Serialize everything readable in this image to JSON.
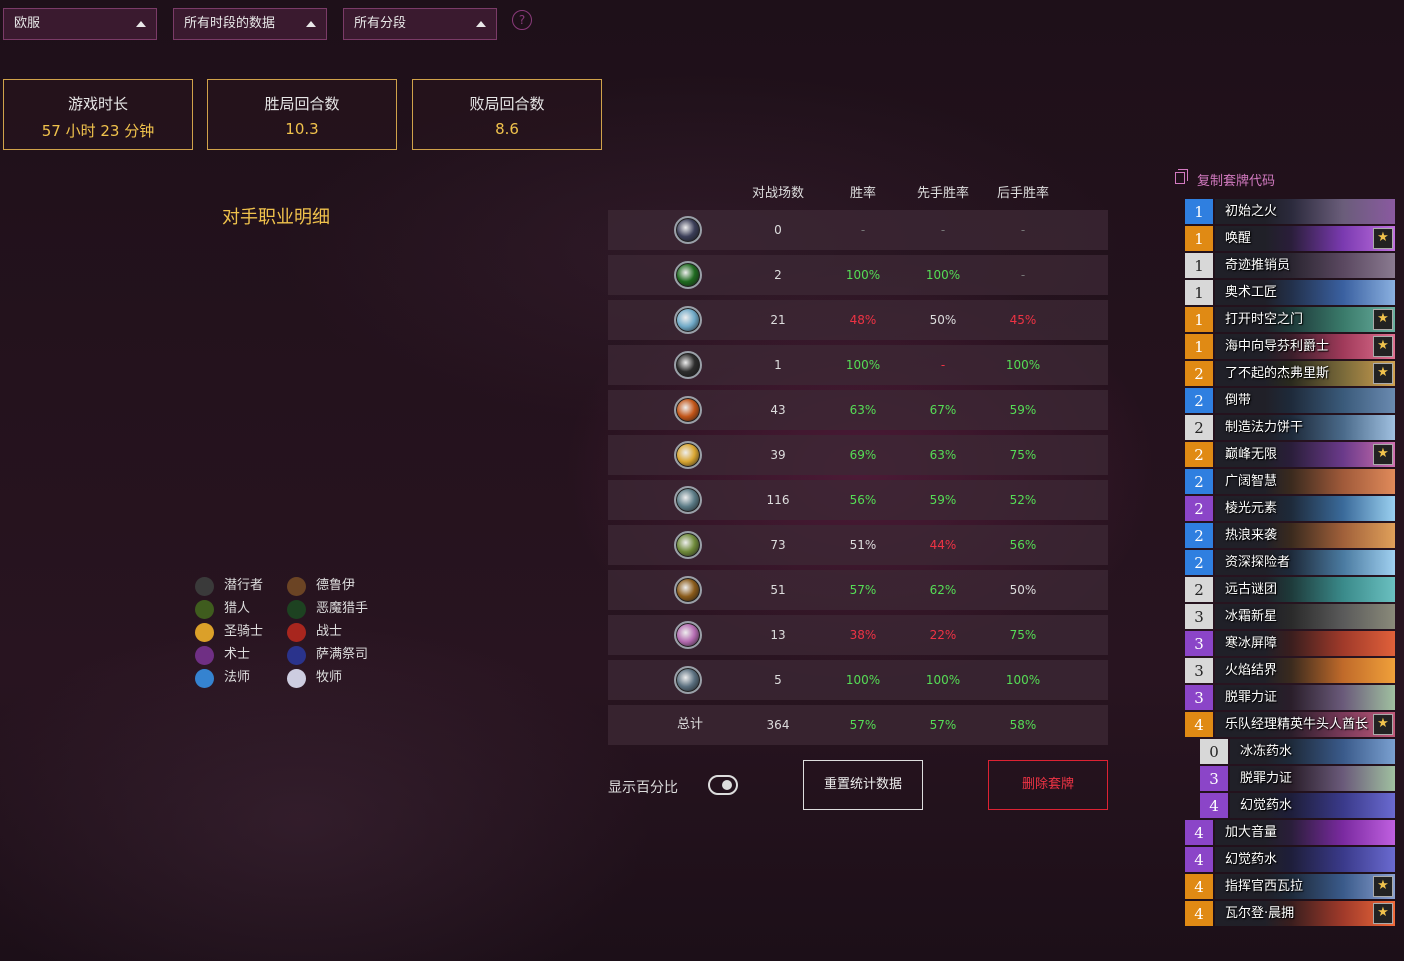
{
  "filters": {
    "region": "欧服",
    "time_range": "所有时段的数据",
    "rank": "所有分段",
    "help": "?"
  },
  "stats": [
    {
      "label": "游戏时长",
      "value": "57 小时 23 分钟"
    },
    {
      "label": "胜局回合数",
      "value": "10.3"
    },
    {
      "label": "败局回合数",
      "value": "8.6"
    }
  ],
  "section_title": "对手职业明细",
  "legend": [
    {
      "label": "潜行者",
      "color": "#3a3a3a"
    },
    {
      "label": "德鲁伊",
      "color": "#6b4424"
    },
    {
      "label": "猎人",
      "color": "#3f5c1e"
    },
    {
      "label": "恶魔猎手",
      "color": "#1d4221"
    },
    {
      "label": "圣骑士",
      "color": "#dba029"
    },
    {
      "label": "战士",
      "color": "#a8261e"
    },
    {
      "label": "术士",
      "color": "#6f2f84"
    },
    {
      "label": "萨满祭司",
      "color": "#2a338c"
    },
    {
      "label": "法师",
      "color": "#3583d0"
    },
    {
      "label": "牧师",
      "color": "#cdcde0"
    }
  ],
  "table": {
    "headers": [
      "对战场数",
      "胜率",
      "先手胜率",
      "后手胜率"
    ],
    "rows": [
      {
        "icon": "unknown-class-icon",
        "icon_color": "#3b3e58",
        "games": "0",
        "wr": "-",
        "wr_s": "dash",
        "first": "-",
        "first_s": "dash",
        "second": "-",
        "second_s": "dash"
      },
      {
        "icon": "demon-hunter-icon",
        "icon_color": "#1f6a20",
        "games": "2",
        "wr": "100%",
        "wr_s": "good",
        "first": "100%",
        "first_s": "good",
        "second": "-",
        "second_s": "dash"
      },
      {
        "icon": "shaman-icon",
        "icon_color": "#6fa9c7",
        "games": "21",
        "wr": "48%",
        "wr_s": "bad",
        "first": "50%",
        "first_s": "neutral",
        "second": "45%",
        "second_s": "bad"
      },
      {
        "icon": "rogue-icon",
        "icon_color": "#2d2d2d",
        "games": "1",
        "wr": "100%",
        "wr_s": "good",
        "first": "-",
        "first_s": "bad",
        "second": "100%",
        "second_s": "good"
      },
      {
        "icon": "warrior-icon",
        "icon_color": "#c25518",
        "games": "43",
        "wr": "63%",
        "wr_s": "good",
        "first": "67%",
        "first_s": "good",
        "second": "59%",
        "second_s": "good"
      },
      {
        "icon": "paladin-icon",
        "icon_color": "#d9a632",
        "games": "39",
        "wr": "69%",
        "wr_s": "good",
        "first": "63%",
        "first_s": "good",
        "second": "75%",
        "second_s": "good"
      },
      {
        "icon": "priest-icon",
        "icon_color": "#5b7b86",
        "games": "116",
        "wr": "56%",
        "wr_s": "good",
        "first": "59%",
        "first_s": "good",
        "second": "52%",
        "second_s": "good"
      },
      {
        "icon": "hunter-icon",
        "icon_color": "#6f8a3a",
        "games": "73",
        "wr": "51%",
        "wr_s": "neutral",
        "first": "44%",
        "first_s": "bad",
        "second": "56%",
        "second_s": "good"
      },
      {
        "icon": "druid-icon",
        "icon_color": "#8a5b1a",
        "games": "51",
        "wr": "57%",
        "wr_s": "good",
        "first": "62%",
        "first_s": "good",
        "second": "50%",
        "second_s": "neutral"
      },
      {
        "icon": "mage-icon",
        "icon_color": "#b36bb0",
        "games": "13",
        "wr": "38%",
        "wr_s": "bad",
        "first": "22%",
        "first_s": "bad",
        "second": "75%",
        "second_s": "good"
      },
      {
        "icon": "warlock-icon",
        "icon_color": "#5a6f7f",
        "games": "5",
        "wr": "100%",
        "wr_s": "good",
        "first": "100%",
        "first_s": "good",
        "second": "100%",
        "second_s": "good"
      }
    ],
    "total": {
      "label": "总计",
      "games": "364",
      "wr": "57%",
      "first": "57%",
      "second": "58%"
    }
  },
  "controls": {
    "show_percent_label": "显示百分比",
    "reset_button": "重置统计数据",
    "delete_button": "删除套牌"
  },
  "deck": {
    "copy_label": "复制套牌代码",
    "cards": [
      {
        "cost": "1",
        "name": "初始之火",
        "rarity": "rare",
        "legendary": false,
        "art": [
          "#2b2a3c",
          "#6a5d7a",
          "#8a5aa0"
        ]
      },
      {
        "cost": "1",
        "name": "唤醒",
        "rarity": "legendary",
        "legendary": true,
        "art": [
          "#2a1e3a",
          "#7a3ab0",
          "#c070e0"
        ]
      },
      {
        "cost": "1",
        "name": "奇迹推销员",
        "rarity": "common",
        "legendary": false,
        "art": [
          "#2a2530",
          "#5a4860",
          "#8a7a90"
        ]
      },
      {
        "cost": "1",
        "name": "奥术工匠",
        "rarity": "common",
        "legendary": false,
        "art": [
          "#22304a",
          "#3a60a0",
          "#8ab0e0"
        ]
      },
      {
        "cost": "1",
        "name": "打开时空之门",
        "rarity": "legendary",
        "legendary": true,
        "art": [
          "#1e3a3a",
          "#3a7a6a",
          "#6ab0a0"
        ]
      },
      {
        "cost": "1",
        "name": "海中向导芬利爵士",
        "rarity": "legendary",
        "legendary": true,
        "art": [
          "#3a1e2a",
          "#a03a5a",
          "#e07090"
        ]
      },
      {
        "cost": "2",
        "name": "了不起的杰弗里斯",
        "rarity": "legendary",
        "legendary": true,
        "art": [
          "#2a2a1e",
          "#7a6a3a",
          "#d0a050"
        ]
      },
      {
        "cost": "2",
        "name": "倒带",
        "rarity": "rare",
        "legendary": false,
        "art": [
          "#1e2a3a",
          "#3a5a7a",
          "#6a8ab0"
        ]
      },
      {
        "cost": "2",
        "name": "制造法力饼干",
        "rarity": "common",
        "legendary": false,
        "art": [
          "#1e2a3a",
          "#4a6a8a",
          "#a0c0e0"
        ]
      },
      {
        "cost": "2",
        "name": "巅峰无限",
        "rarity": "legendary",
        "legendary": true,
        "art": [
          "#2a1e3a",
          "#6a3a8a",
          "#d070b0"
        ]
      },
      {
        "cost": "2",
        "name": "广阔智慧",
        "rarity": "rare",
        "legendary": false,
        "art": [
          "#3a2a1e",
          "#a05a3a",
          "#e08a5a"
        ]
      },
      {
        "cost": "2",
        "name": "棱光元素",
        "rarity": "epic",
        "legendary": false,
        "art": [
          "#1e2a3a",
          "#3a6a9a",
          "#9ad0f0"
        ]
      },
      {
        "cost": "2",
        "name": "热浪来袭",
        "rarity": "rare",
        "legendary": false,
        "art": [
          "#3a2a1e",
          "#a0603a",
          "#e0a05a"
        ]
      },
      {
        "cost": "2",
        "name": "资深探险者",
        "rarity": "rare",
        "legendary": false,
        "art": [
          "#1e2a3a",
          "#4a7aa0",
          "#a0d0f0"
        ]
      },
      {
        "cost": "2",
        "name": "远古谜团",
        "rarity": "common",
        "legendary": false,
        "art": [
          "#1e3a3a",
          "#3a8a8a",
          "#6ac0c0"
        ]
      },
      {
        "cost": "3",
        "name": "冰霜新星",
        "rarity": "common",
        "legendary": false,
        "art": [
          "#2a2a2a",
          "#5a5a5a",
          "#8a8a7a"
        ]
      },
      {
        "cost": "3",
        "name": "寒冰屏障",
        "rarity": "epic",
        "legendary": false,
        "art": [
          "#3a1e1e",
          "#a03a2a",
          "#e0603a"
        ]
      },
      {
        "cost": "3",
        "name": "火焰结界",
        "rarity": "common",
        "legendary": false,
        "art": [
          "#3a2a1e",
          "#c06a2a",
          "#f0a03a"
        ]
      },
      {
        "cost": "3",
        "name": "脱罪力证",
        "rarity": "epic",
        "legendary": false,
        "art": [
          "#2a1e2a",
          "#6a5a7a",
          "#a0c0a0"
        ]
      },
      {
        "cost": "4",
        "name": "乐队经理精英牛头人酋长",
        "rarity": "legendary",
        "legendary": true,
        "art": [
          "#2a1e2a",
          "#7a3a5a",
          "#c05a7a"
        ]
      },
      {
        "cost": "0",
        "name": "冰冻药水",
        "rarity": "common",
        "legendary": false,
        "indent": true,
        "art": [
          "#1e2a3a",
          "#3a5a8a",
          "#7aa0d0"
        ]
      },
      {
        "cost": "3",
        "name": "脱罪力证",
        "rarity": "epic",
        "legendary": false,
        "indent": true,
        "art": [
          "#2a1e2a",
          "#6a5a7a",
          "#a0c0a0"
        ]
      },
      {
        "cost": "4",
        "name": "幻觉药水",
        "rarity": "epic",
        "legendary": false,
        "indent": true,
        "art": [
          "#1e1e3a",
          "#3a3a8a",
          "#6a6ad0"
        ]
      },
      {
        "cost": "4",
        "name": "加大音量",
        "rarity": "epic",
        "legendary": false,
        "art": [
          "#2a1e3a",
          "#7a2aa0",
          "#c060e0"
        ]
      },
      {
        "cost": "4",
        "name": "幻觉药水",
        "rarity": "epic",
        "legendary": false,
        "art": [
          "#1e1e3a",
          "#3a3a8a",
          "#6a6ad0"
        ]
      },
      {
        "cost": "4",
        "name": "指挥官西瓦拉",
        "rarity": "legendary",
        "legendary": true,
        "art": [
          "#1e2a3a",
          "#3a5a8a",
          "#8aa0d0"
        ]
      },
      {
        "cost": "4",
        "name": "瓦尔登·晨拥",
        "rarity": "legendary",
        "legendary": true,
        "art": [
          "#3a1e1e",
          "#a03a2a",
          "#f06a3a"
        ]
      }
    ]
  },
  "colors": {
    "gold": "#f0c24c",
    "good": "#55dd55",
    "bad": "#ee3344",
    "rarity": {
      "common": "#d8d8d8",
      "rare": "#2f7fe0",
      "epic": "#8b45c8",
      "legendary": "#e08a14"
    }
  }
}
